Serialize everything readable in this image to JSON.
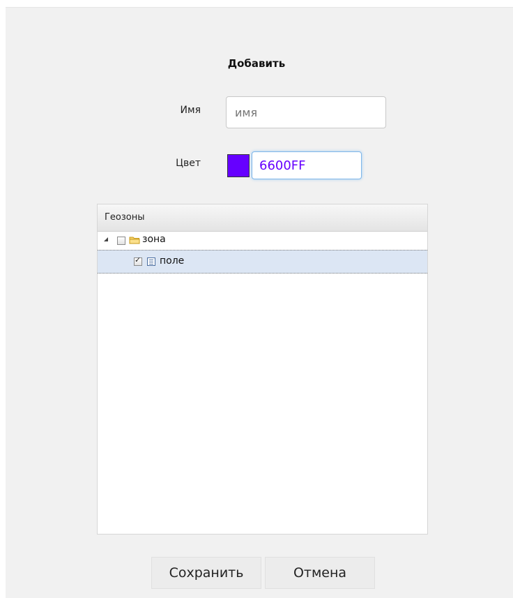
{
  "dialog": {
    "title": "Добавить",
    "name_label": "Имя",
    "name_placeholder": "имя",
    "color_label": "Цвет",
    "color_value": "6600FF",
    "color_swatch": "#6600FF"
  },
  "tree": {
    "header": "Геозоны",
    "items": [
      {
        "label": "зона",
        "type": "folder",
        "checked": false,
        "expanded": true
      },
      {
        "label": "поле",
        "type": "item",
        "checked": true,
        "selected": true
      }
    ]
  },
  "buttons": {
    "save": "Сохранить",
    "cancel": "Отмена"
  }
}
